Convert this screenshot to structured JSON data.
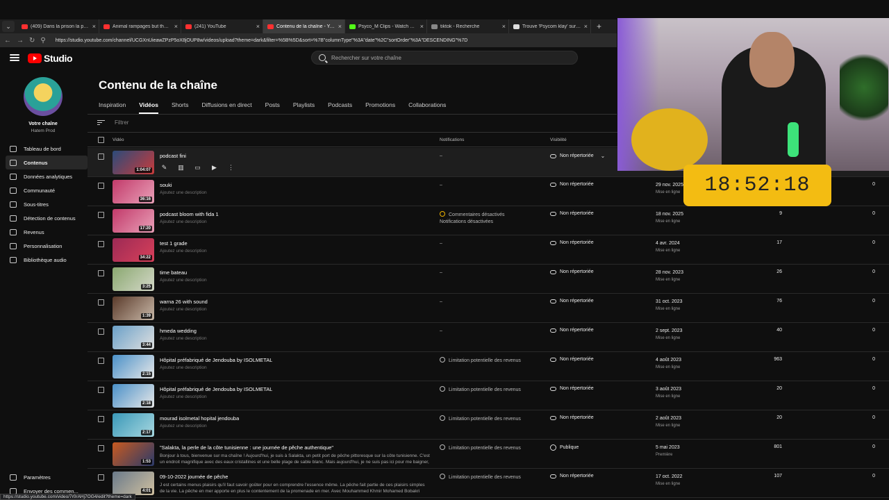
{
  "browser": {
    "tabs": [
      {
        "title": "(409) Dans la prison la plus surpe",
        "color": "#ff3030"
      },
      {
        "title": "Animal rampages but they get inc",
        "color": "#ff3030"
      },
      {
        "title": "(241) YouTube",
        "color": "#ff3030"
      },
      {
        "title": "Contenu de la chaîne - YouTube S",
        "color": "#ff3030",
        "active": true
      },
      {
        "title": "Psyco_M Clips - Watch Live on Ki",
        "color": "#53fc18"
      },
      {
        "title": "tiktok - Recherche",
        "color": "#888888"
      },
      {
        "title": "Trouve 'Psycom klay' sur TikTok |",
        "color": "#dddddd"
      }
    ],
    "url": "https://studio.youtube.com/channel/UCGXnUieawZPzP5oX8jOUP8w/videos/upload?theme=dark&filter=%5B%5D&sort=%7B\"columnType\"%3A\"date\"%2C\"sortOrder\"%3A\"DESCENDING\"%7D",
    "status_url": "https://studio.youtube.com/video/7r0rAHj7OG4/edit?theme=dark"
  },
  "header": {
    "logo_text": "Studio",
    "search_placeholder": "Rechercher sur votre chaîne"
  },
  "sidebar": {
    "channel_title": "Votre chaîne",
    "channel_name": "Hatem Prod",
    "items": [
      {
        "label": "Tableau de bord",
        "icon": "dashboard-icon"
      },
      {
        "label": "Contenus",
        "icon": "content-icon",
        "active": true
      },
      {
        "label": "Données analytiques",
        "icon": "analytics-icon"
      },
      {
        "label": "Communauté",
        "icon": "community-icon"
      },
      {
        "label": "Sous-titres",
        "icon": "subtitles-icon"
      },
      {
        "label": "Détection de contenus",
        "icon": "detection-icon"
      },
      {
        "label": "Revenus",
        "icon": "earn-icon"
      },
      {
        "label": "Personnalisation",
        "icon": "customization-icon"
      },
      {
        "label": "Bibliothèque audio",
        "icon": "audio-library-icon"
      }
    ],
    "bottom": [
      {
        "label": "Paramètres",
        "icon": "settings-icon"
      },
      {
        "label": "Envoyer des commen...",
        "icon": "feedback-icon"
      }
    ]
  },
  "main": {
    "title": "Contenu de la chaîne",
    "tabs": [
      "Inspiration",
      "Vidéos",
      "Shorts",
      "Diffusions en direct",
      "Posts",
      "Playlists",
      "Podcasts",
      "Promotions",
      "Collaborations"
    ],
    "active_tab": "Vidéos",
    "filter_placeholder": "Filtrer",
    "columns": {
      "video": "Vidéo",
      "notifications": "Notifications",
      "visibility": "Visibilité"
    },
    "videos": [
      {
        "title": "podcast fini",
        "desc": "",
        "duration": "1:04:07",
        "notif": "–",
        "visibility": "Non répertoriée",
        "date": "",
        "date_sub": "",
        "views": "",
        "comments": "",
        "hover": true,
        "thumb": [
          "#2b4b7a",
          "#c93b3b"
        ]
      },
      {
        "title": "souki",
        "desc": "Ajoutez une description",
        "duration": "36:16",
        "notif": "–",
        "visibility": "Non répertoriée",
        "date": "29 nov. 2025",
        "date_sub": "Mise en ligne",
        "views": "",
        "comments": "0",
        "thumb": [
          "#c23a6a",
          "#e9a0b8"
        ]
      },
      {
        "title": "podcast bloom with fida 1",
        "desc": "Ajoutez une description",
        "duration": "17:20",
        "notif": "Commentaires désactivés",
        "notif2": "Notifications désactivées",
        "warn": true,
        "visibility": "Non répertoriée",
        "date": "18 nov. 2025",
        "date_sub": "Mise en ligne",
        "views": "9",
        "comments": "0",
        "thumb": [
          "#c23a6a",
          "#e9a0b8"
        ]
      },
      {
        "title": "test 1 grade",
        "desc": "Ajoutez une description",
        "duration": "34:22",
        "notif": "–",
        "visibility": "Non répertoriée",
        "date": "4 avr. 2024",
        "date_sub": "Mise en ligne",
        "views": "17",
        "comments": "0",
        "thumb": [
          "#9c2a55",
          "#d8405a"
        ]
      },
      {
        "title": "time bateau",
        "desc": "Ajoutez une description",
        "duration": "3:25",
        "notif": "–",
        "visibility": "Non répertoriée",
        "date": "28 nov. 2023",
        "date_sub": "Mise en ligne",
        "views": "26",
        "comments": "0",
        "thumb": [
          "#8aa870",
          "#d4d8c8"
        ]
      },
      {
        "title": "warna 26 with sound",
        "desc": "Ajoutez une description",
        "duration": "1:39",
        "notif": "–",
        "visibility": "Non répertoriée",
        "date": "31 oct. 2023",
        "date_sub": "Mise en ligne",
        "views": "76",
        "comments": "0",
        "thumb": [
          "#5a3a2a",
          "#c8b8a8"
        ]
      },
      {
        "title": "hmeda wedding",
        "desc": "Ajoutez une description",
        "duration": "3:44",
        "notif": "–",
        "visibility": "Non répertoriée",
        "date": "2 sept. 2023",
        "date_sub": "Mise en ligne",
        "views": "40",
        "comments": "0",
        "thumb": [
          "#6aa0c8",
          "#e0e0e0"
        ]
      },
      {
        "title": "Hôpital préfabriqué de Jendouba by ISOLMETAL",
        "desc": "Ajoutez une description",
        "duration": "2:15",
        "notif": "Limitation potentielle des revenus",
        "info": true,
        "visibility": "Non répertoriée",
        "date": "4 août 2023",
        "date_sub": "Mise en ligne",
        "views": "963",
        "comments": "0",
        "thumb": [
          "#4a90c8",
          "#e8e8e8"
        ]
      },
      {
        "title": "Hôpital préfabriqué de Jendouba by ISOLMETAL",
        "desc": "Ajoutez une description",
        "duration": "2:18",
        "notif": "Limitation potentielle des revenus",
        "info": true,
        "visibility": "Non répertoriée",
        "date": "3 août 2023",
        "date_sub": "Mise en ligne",
        "views": "20",
        "comments": "0",
        "thumb": [
          "#4a90c8",
          "#e8e8e8"
        ]
      },
      {
        "title": "mourad isolmetal hopital jendouba",
        "desc": "Ajoutez une description",
        "duration": "2:17",
        "notif": "Limitation potentielle des revenus",
        "info": true,
        "visibility": "Non répertoriée",
        "date": "2 août 2023",
        "date_sub": "Mise en ligne",
        "views": "20",
        "comments": "0",
        "thumb": [
          "#3a98b8",
          "#a8d8e0"
        ]
      },
      {
        "title": "\"Salakta, la perle de la côte tunisienne : une journée de pêche authentique\"",
        "desc": "Bonjour à tous, bienvenue sur ma chaîne ! Aujourd'hui, je suis à Salakta, un petit port de pêche pittoresque sur la côte tunisienne. C'est un endroit magnifique avec des eaux cristallines et une belle plage de sable blanc. Mais aujourd'hui, je ne suis pas ici pour me baigner, je suis ici pour une...",
        "long": true,
        "duration": "1:53",
        "notif": "Limitation potentielle des revenus",
        "info": true,
        "visibility": "Publique",
        "globe": true,
        "date": "5 mai 2023",
        "date_sub": "Première",
        "views": "801",
        "comments": "0",
        "thumb": [
          "#c85a20",
          "#2a3a6a"
        ]
      },
      {
        "title": "09-10-2022 journée de pêche",
        "desc": "J est certains menus plaisirs qu'il faut savoir goûter pour en comprendre l'essence même. La pêche fait partie de ces plaisirs simples de la vie. La pêche en mer apporte en plus le contentement de la promenade en mer. Avec Mouhammed Khmir Mohamed Bobakri Barhoum et hatem",
        "long": true,
        "duration": "4:01",
        "notif": "Limitation potentielle des revenus",
        "info": true,
        "visibility": "Non répertoriée",
        "date": "17 oct. 2022",
        "date_sub": "Mise en ligne",
        "views": "107",
        "comments": "0",
        "thumb": [
          "#6a7a8a",
          "#d0c0a0"
        ]
      }
    ]
  },
  "overlay": {
    "clock": "18:52:18",
    "clock_color": "#f3bc12"
  }
}
